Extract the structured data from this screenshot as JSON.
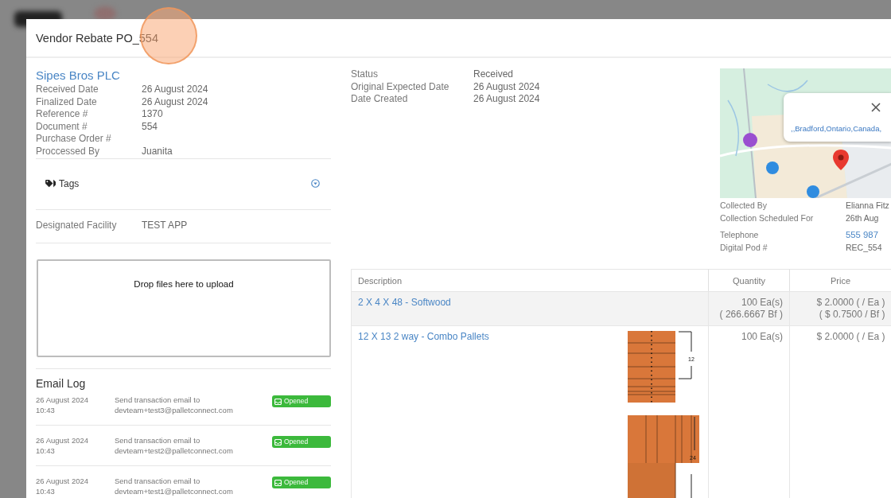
{
  "modal": {
    "title": "Vendor Rebate PO_554"
  },
  "vendor": {
    "name": "Sipes Bros PLC",
    "fields": [
      {
        "label": "Received Date",
        "value": "26 August 2024"
      },
      {
        "label": "Finalized Date",
        "value": "26 August 2024"
      },
      {
        "label": "Reference #",
        "value": "1370"
      },
      {
        "label": "Document #",
        "value": "554"
      },
      {
        "label": "Purchase Order #"
      },
      {
        "label": "Proccessed By",
        "value": "Juanita"
      }
    ]
  },
  "tags": {
    "label": "Tags",
    "expanded": false
  },
  "facility": {
    "label": "Designated Facility",
    "value": "TEST APP"
  },
  "upload": {
    "prompt": "Drop files here to upload"
  },
  "email_log": {
    "title": "Email Log",
    "entries": [
      {
        "date": "26 August 2024",
        "time": "10:43",
        "message": "Send transaction email to devteam+test3@palletconnect.com",
        "status": "Opened"
      },
      {
        "date": "26 August 2024",
        "time": "10:43",
        "message": "Send transaction email to devteam+test2@palletconnect.com",
        "status": "Opened"
      },
      {
        "date": "26 August 2024",
        "time": "10:43",
        "message": "Send transaction email to devteam+test1@palletconnect.com",
        "status": "Opened"
      }
    ]
  },
  "status_fields": [
    {
      "label": "Status",
      "value": "Received"
    },
    {
      "label": "Original Expected Date",
      "value": "26 August 2024"
    },
    {
      "label": "Date Created",
      "value": "26 August 2024"
    }
  ],
  "map": {
    "popup": {
      "address": ",,Bradford,Ontario,Canada,"
    }
  },
  "collection_fields": [
    {
      "label": "Collected By",
      "value": "Elianna Fitz"
    },
    {
      "label": "Collection Scheduled For",
      "value": "26th Aug"
    }
  ],
  "contact_fields": [
    {
      "label": "Telephone",
      "value": "555 987",
      "kind": "link"
    },
    {
      "label": "Digital Pod #",
      "value": "REC_554",
      "kind": "text"
    }
  ],
  "items": {
    "columns": [
      "Description",
      "Quantity",
      "Price"
    ],
    "rows": [
      {
        "description": "2 X 4 X 48 - Softwood",
        "quantity": [
          "100 Ea(s)",
          "( 266.6667 Bf )"
        ],
        "price": [
          "$ 2.0000 ( / Ea )",
          "( $ 0.7500 / Bf )"
        ],
        "highlighted": true
      },
      {
        "description": "12 X 13 2 way - Combo Pallets",
        "quantity": [
          "100 Ea(s)"
        ],
        "price": [
          "$ 2.0000 ( / Ea )"
        ],
        "highlighted": false,
        "drawing": {
          "labels": [
            "12",
            "24"
          ]
        }
      }
    ]
  }
}
